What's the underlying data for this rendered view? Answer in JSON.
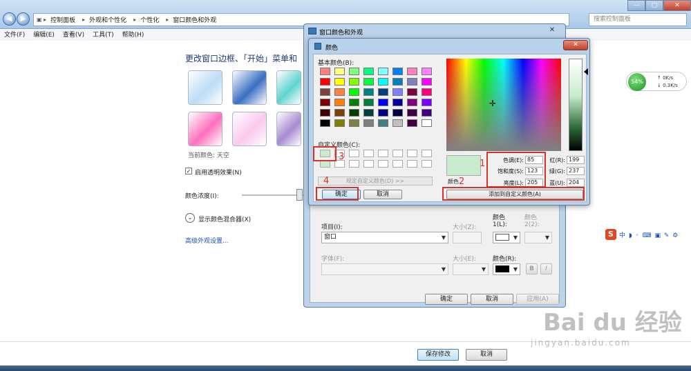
{
  "explorer": {
    "breadcrumbs": [
      "控制面板",
      "外观和个性化",
      "个性化",
      "窗口颜色和外观"
    ],
    "search_placeholder": "搜索控制面板",
    "menu": [
      "文件(F)",
      "编辑(E)",
      "查看(V)",
      "工具(T)",
      "帮助(H)"
    ]
  },
  "main": {
    "title": "更改窗口边框、「开始」菜单和",
    "current_color": "当前颜色: 天空",
    "transparency_label": "启用透明效果(N)",
    "transparency_checked": true,
    "intensity_label": "颜色浓度(I):",
    "mixer_label": "显示颜色混合器(X)",
    "advanced_link": "高级外观设置...",
    "save_button": "保存修改",
    "cancel_button": "取消",
    "swatches": [
      "#bcdcf6",
      "#3a6fc2",
      "#5fd4d0",
      "#d8d8d8",
      "#ff6fbf",
      "#fbc8ee",
      "#a78ad0"
    ]
  },
  "widgets": {
    "net_percent": "54%",
    "net_up": "0K/s",
    "net_down": "0.3K/s",
    "ime": "中 ◗ ◦ ⌨ ▣ ✎ ⚙"
  },
  "outer_dialog": {
    "title": "窗口颜色和外观",
    "item_label": "项目(I):",
    "item_value": "窗口",
    "size_label": "大小(Z):",
    "color1_label": "颜色\n1(L):",
    "color2_label": "颜色\n2(2):",
    "font_label": "字体(F):",
    "font_size_label": "大小(E):",
    "font_color_label": "颜色(R):",
    "bold": "B",
    "italic": "I",
    "ok": "确定",
    "cancel": "取消",
    "apply": "应用(A)"
  },
  "color_dialog": {
    "title": "颜色",
    "basic_label": "基本颜色(B):",
    "custom_label": "自定义颜色(C):",
    "define_button": "规定自定义颜色(D) >>",
    "ok": "确定",
    "cancel": "取消",
    "preview_label": "颜色",
    "hue_label": "色调(E):",
    "hue": "85",
    "sat_label": "饱和度(S):",
    "sat": "123",
    "lum_label": "亮度(L):",
    "lum": "205",
    "red_label": "红(R):",
    "red": "199",
    "green_label": "绿(G):",
    "green": "237",
    "blue_label": "蓝(U):",
    "blue": "204",
    "add_custom": "添加到自定义颜色(A)",
    "preview_color": "#c7edcc",
    "basic_colors": [
      "#ff8080",
      "#ffff80",
      "#80ff80",
      "#00ff80",
      "#80ffff",
      "#0080ff",
      "#ff80c0",
      "#ff80ff",
      "#ff0000",
      "#ffff00",
      "#80ff00",
      "#00ff40",
      "#00ffff",
      "#0080c0",
      "#8080c0",
      "#ff00ff",
      "#804040",
      "#ff8040",
      "#00ff00",
      "#008080",
      "#004080",
      "#8080ff",
      "#800040",
      "#ff0080",
      "#800000",
      "#ff8000",
      "#008000",
      "#008040",
      "#0000ff",
      "#0000a0",
      "#800080",
      "#8000ff",
      "#400000",
      "#804000",
      "#004000",
      "#004040",
      "#000080",
      "#000040",
      "#400040",
      "#400080",
      "#000000",
      "#808000",
      "#808040",
      "#808080",
      "#408080",
      "#c0c0c0",
      "#400040",
      "#ffffff"
    ],
    "custom_colors": [
      "#c7edcc",
      "#ffffff",
      "#ffffff",
      "#ffffff",
      "#ffffff",
      "#ffffff",
      "#ffffff",
      "#ffffff",
      "#c7edcc",
      "#ffffff",
      "#ffffff",
      "#ffffff",
      "#ffffff",
      "#ffffff",
      "#ffffff",
      "#ffffff"
    ]
  },
  "annotations": [
    "1",
    "2",
    "3",
    "4"
  ],
  "watermark": {
    "text": "Bai du 经验",
    "url": "jingyan.baidu.com"
  }
}
